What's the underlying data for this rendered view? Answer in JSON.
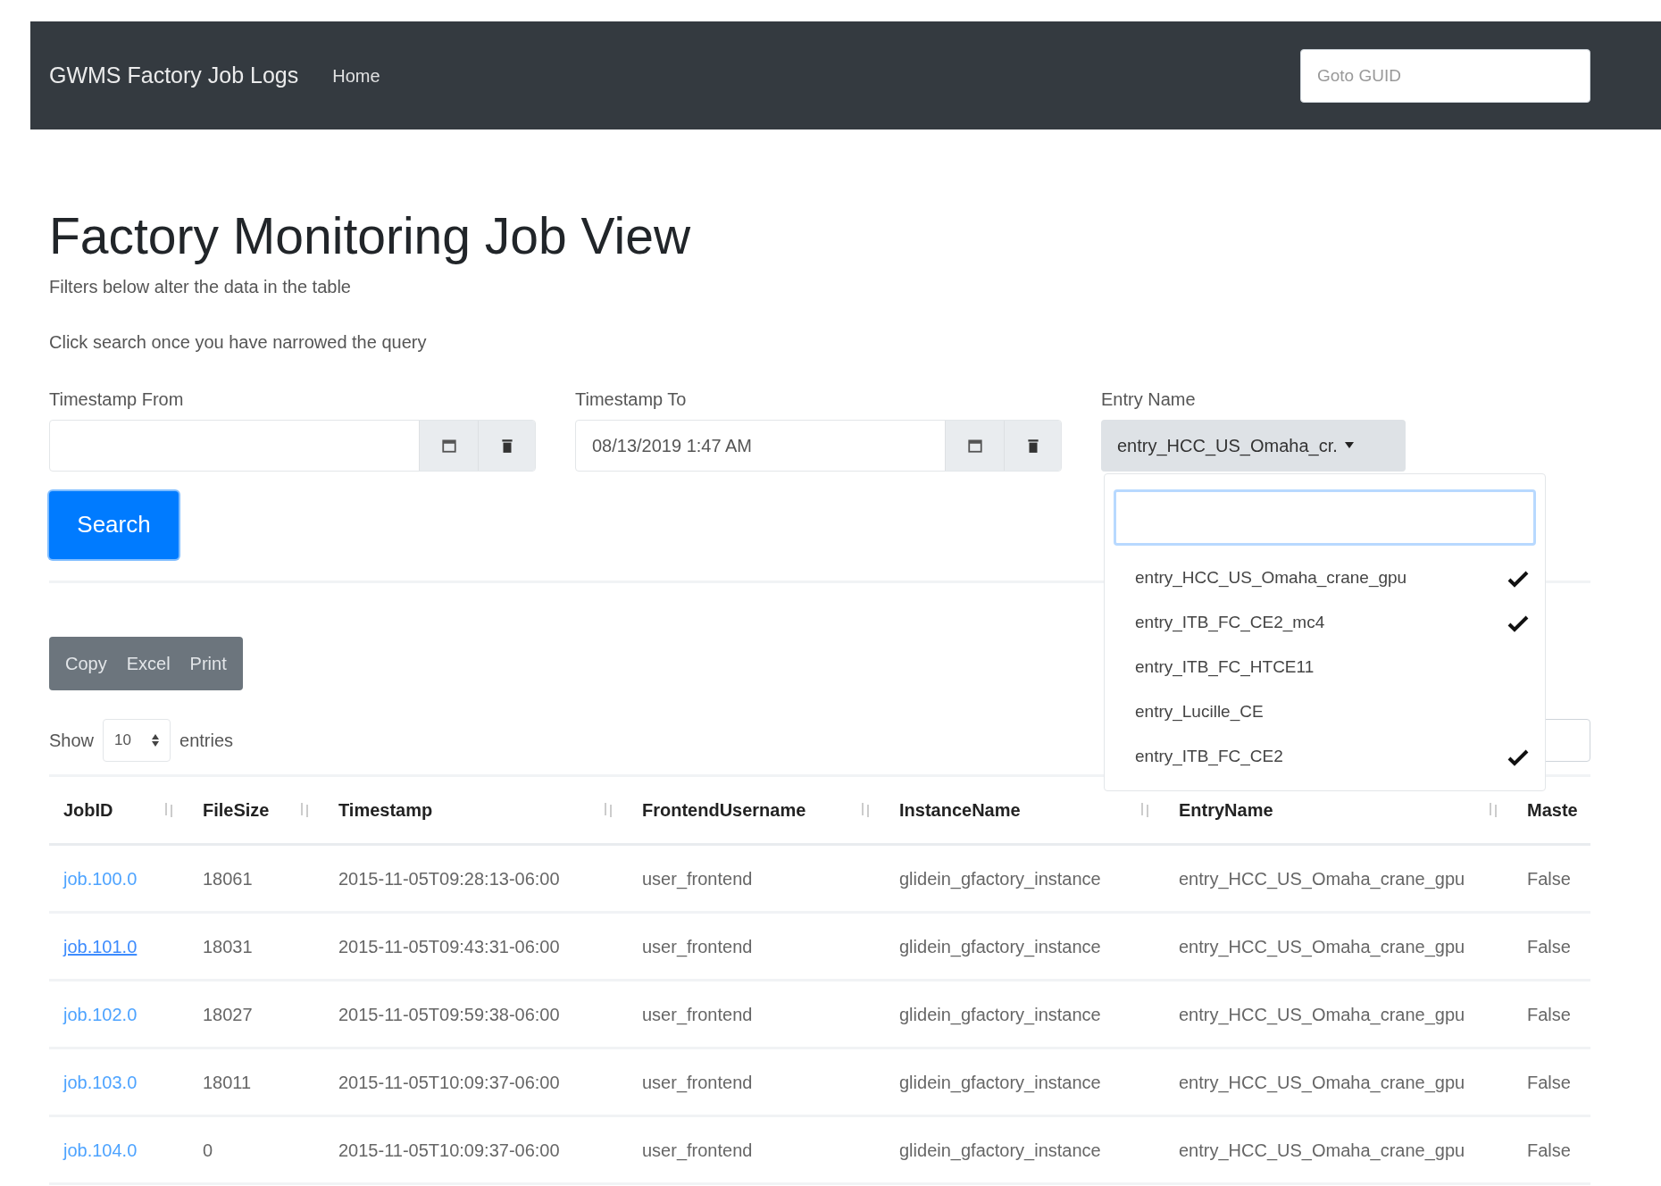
{
  "navbar": {
    "brand": "GWMS Factory Job Logs",
    "links": [
      {
        "label": "Home"
      }
    ],
    "goto_field": {
      "placeholder": "Goto GUID"
    }
  },
  "page": {
    "title": "Factory Monitoring Job View",
    "notes": [
      "Filters below alter the data in the table",
      "Click search once you have narrowed the query"
    ]
  },
  "filters": [
    {
      "kind": "datetime",
      "label": "Timestamp From"
    },
    {
      "kind": "datetime",
      "label": "Timestamp To",
      "value": "08/13/2019 1:47 AM"
    },
    {
      "kind": "multiselect",
      "label": "Entry Name",
      "value": "entry_HCC_US_Omaha_cr.",
      "expanded": true,
      "options": [
        {
          "label": "entry_HCC_US_Omaha_crane_gpu",
          "checked": true
        },
        {
          "label": "entry_ITB_FC_CE2_mc4",
          "checked": true
        },
        {
          "label": "entry_ITB_FC_HTCE11",
          "checked": false
        },
        {
          "label": "entry_Lucille_CE",
          "checked": false
        },
        {
          "label": "entry_ITB_FC_CE2",
          "checked": true
        }
      ]
    }
  ],
  "search_button": "Search",
  "export_buttons": [
    "Copy",
    "Excel",
    "Print"
  ],
  "length_menu": {
    "before": "Show",
    "value": "10",
    "after": "entries"
  },
  "table": {
    "columns": [
      "JobID",
      "FileSize",
      "Timestamp",
      "FrontendUsername",
      "InstanceName",
      "EntryName",
      "Maste"
    ],
    "rows": [
      {
        "hovered": false,
        "cells": [
          "job.100.0",
          "18061",
          "2015-11-05T09:28:13-06:00",
          "user_frontend",
          "glidein_gfactory_instance",
          "entry_HCC_US_Omaha_crane_gpu",
          "False"
        ]
      },
      {
        "hovered": true,
        "cells": [
          "job.101.0",
          "18031",
          "2015-11-05T09:43:31-06:00",
          "user_frontend",
          "glidein_gfactory_instance",
          "entry_HCC_US_Omaha_crane_gpu",
          "False"
        ]
      },
      {
        "hovered": false,
        "cells": [
          "job.102.0",
          "18027",
          "2015-11-05T09:59:38-06:00",
          "user_frontend",
          "glidein_gfactory_instance",
          "entry_HCC_US_Omaha_crane_gpu",
          "False"
        ]
      },
      {
        "hovered": false,
        "cells": [
          "job.103.0",
          "18011",
          "2015-11-05T10:09:37-06:00",
          "user_frontend",
          "glidein_gfactory_instance",
          "entry_HCC_US_Omaha_crane_gpu",
          "False"
        ]
      },
      {
        "hovered": false,
        "cells": [
          "job.104.0",
          "0",
          "2015-11-05T10:09:37-06:00",
          "user_frontend",
          "glidein_gfactory_instance",
          "entry_HCC_US_Omaha_crane_gpu",
          "False"
        ]
      }
    ]
  }
}
